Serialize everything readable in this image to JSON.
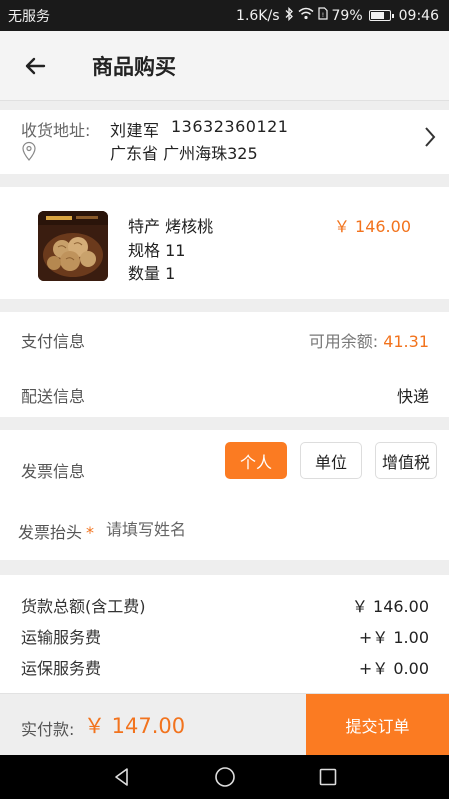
{
  "status_bar": {
    "carrier": "无服务",
    "speed": "1.6K/s",
    "battery": "79%",
    "battery_level": 0.79,
    "time": "09:46"
  },
  "header": {
    "title": "商品购买"
  },
  "address": {
    "label": "收货地址:",
    "name": "刘建军",
    "phone": "13632360121",
    "detail": "广东省 广州海珠325"
  },
  "product": {
    "name": "特产 烤核桃",
    "spec": "规格 11",
    "quantity": "数量 1",
    "price": "￥ 146.00"
  },
  "payment": {
    "label": "支付信息",
    "balance_label": "可用余额:",
    "balance_value": "41.31",
    "delivery_label": "配送信息",
    "delivery_value": "快递"
  },
  "invoice": {
    "label": "发票信息",
    "options": [
      "个人",
      "单位",
      "增值税"
    ],
    "selected": "个人",
    "header_label": "发票抬头",
    "required_mark": "*",
    "header_placeholder": "请填写姓名"
  },
  "summary": {
    "items": [
      {
        "label": "货款总额(含工费)",
        "value": "￥ 146.00"
      },
      {
        "label": "运输服务费",
        "value": "+￥ 1.00"
      },
      {
        "label": "运保服务费",
        "value": "+￥ 0.00"
      }
    ]
  },
  "footer": {
    "pay_label": "实付款:",
    "pay_amount": "￥ 147.00",
    "submit_label": "提交订单"
  },
  "colors": {
    "accent": "#fb7b22",
    "price": "#f2731d",
    "background": "#eeeeee"
  }
}
